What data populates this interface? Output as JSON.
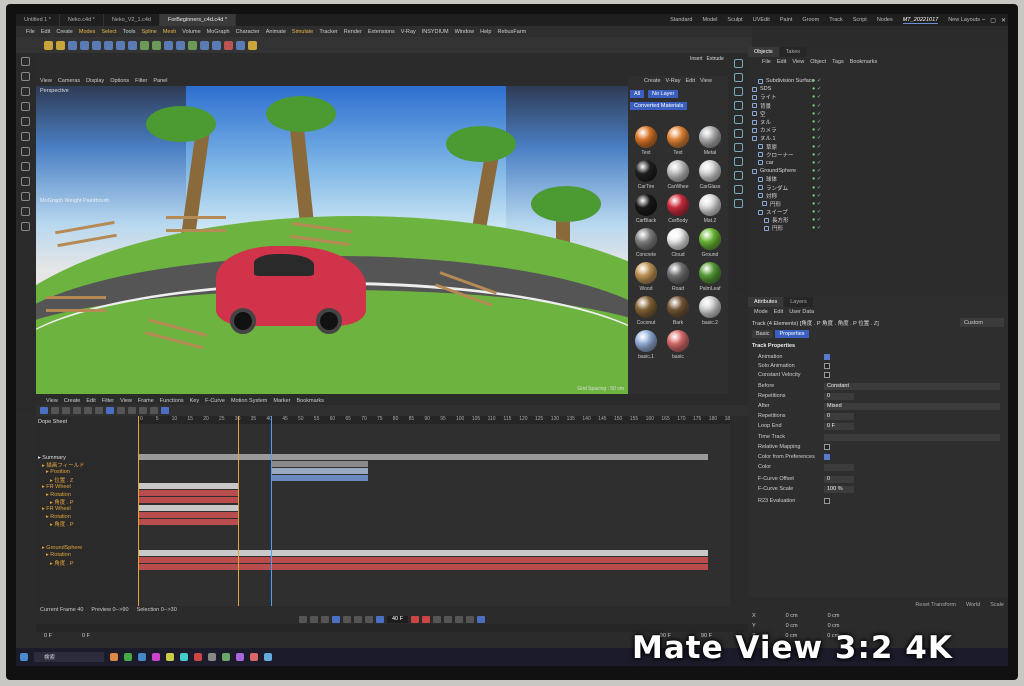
{
  "tabs": [
    "Untitled 1 *",
    "Neko.c4d *",
    "Neko_V2_1.c4d",
    "ForBeginners_c4d.c4d *"
  ],
  "layouts": [
    "Standard",
    "Model",
    "Sculpt",
    "UVEdit",
    "Paint",
    "Groom",
    "Track",
    "Script",
    "Nodes",
    "MT_20221017",
    "New Layouts"
  ],
  "menu": [
    "File",
    "Edit",
    "Create",
    "Modes",
    "Select",
    "Tools",
    "Spline",
    "Mesh",
    "Volume",
    "MoGraph",
    "Character",
    "Animate",
    "Simulate",
    "Tracker",
    "Render",
    "Extensions",
    "V-Ray",
    "INSYDIUM",
    "Window",
    "Help",
    "RebusFarm"
  ],
  "viewport": {
    "menu": [
      "View",
      "Cameras",
      "Display",
      "Options",
      "Filter",
      "Panel"
    ],
    "label": "Perspective",
    "tool": "MoGraph Weight Paintbrush",
    "status": "Grid Spacing : 50 cm"
  },
  "materials": {
    "menu": [
      "Create",
      "V-Ray",
      "Edit",
      "View"
    ],
    "chips": [
      "All",
      "No Layer",
      "Converted Materials"
    ],
    "items": [
      {
        "name": "Text",
        "color": "#e07a2a"
      },
      {
        "name": "Text",
        "color": "#e88a3a"
      },
      {
        "name": "Metal",
        "color": "#b5b5b5"
      },
      {
        "name": "CarTire",
        "color": "#222222"
      },
      {
        "name": "CarWhee",
        "color": "#c8c8c8"
      },
      {
        "name": "CarGlass",
        "color": "#dcdcdc"
      },
      {
        "name": "CarBlack",
        "color": "#1a1a1a"
      },
      {
        "name": "CarBody",
        "color": "#d23040"
      },
      {
        "name": "Mat.2",
        "color": "#e0e0e0"
      },
      {
        "name": "Concrete",
        "color": "#888888"
      },
      {
        "name": "Cloud",
        "color": "#f2f2f2"
      },
      {
        "name": "Ground",
        "color": "#6fbf3a"
      },
      {
        "name": "Wood",
        "color": "#c79a5a"
      },
      {
        "name": "Road",
        "color": "#777777"
      },
      {
        "name": "PalmLeaf",
        "color": "#5aa23a"
      },
      {
        "name": "Coconut",
        "color": "#8a6a3a"
      },
      {
        "name": "Bark",
        "color": "#7a5a3a"
      },
      {
        "name": "basic.2",
        "color": "#d8d8d8"
      },
      {
        "name": "basic.1",
        "color": "#9ab6e0"
      },
      {
        "name": "basic",
        "color": "#e07070"
      }
    ]
  },
  "insert": [
    "Insert",
    "Extrude"
  ],
  "objects": {
    "tabs": [
      "Objects",
      "Takes"
    ],
    "menu": [
      "File",
      "Edit",
      "View",
      "Object",
      "Tags",
      "Bookmarks"
    ],
    "items": [
      "Subdivision Surface",
      "SDS",
      "ライト",
      "背景",
      "空",
      "ヌル",
      "カメラ",
      "ヌル.1",
      "草原",
      "クローナー",
      "car",
      "GroundSphere",
      "球体",
      "ランダム",
      "対称",
      "円形",
      "スイープ",
      "長方形",
      "円形"
    ]
  },
  "attributes": {
    "tabs": [
      "Attributes",
      "Layers"
    ],
    "menu": [
      "Mode",
      "Edit",
      "User Data"
    ],
    "title": "Track (4 Elements) [角度 . P 角度 . 角度 . P 位置 . Z]",
    "custom": "Custom",
    "subtabs": [
      "Basic",
      "Properties"
    ],
    "section": "Track Properties",
    "rows": [
      {
        "label": "Animation",
        "type": "cb",
        "on": true
      },
      {
        "label": "Solo Animation",
        "type": "cb",
        "on": false
      },
      {
        "label": "Constant Velocity",
        "type": "cb",
        "on": false
      },
      {
        "label": "Before",
        "type": "val",
        "value": "Constant"
      },
      {
        "label": "Repetitions",
        "type": "val",
        "value": "0"
      },
      {
        "label": "After",
        "type": "val",
        "value": "Mixed"
      },
      {
        "label": "Repetitions",
        "type": "val",
        "value": "0"
      },
      {
        "label": "Loop End",
        "type": "val",
        "value": "0 F"
      },
      {
        "label": "Time Track",
        "type": "val",
        "value": ""
      },
      {
        "label": "Relative Mapping",
        "type": "cb",
        "on": false
      },
      {
        "label": "Color from Preferences",
        "type": "cb",
        "on": true
      },
      {
        "label": "Color",
        "type": "val",
        "value": ""
      },
      {
        "label": "F-Curve Offset",
        "type": "val",
        "value": "0"
      },
      {
        "label": "F-Curve Scale",
        "type": "val",
        "value": "100 %"
      },
      {
        "label": "R23 Evaluation",
        "type": "cb",
        "on": false
      }
    ]
  },
  "coords": {
    "header": [
      "Reset Transform",
      "World",
      "Scale"
    ],
    "rows": [
      [
        "X",
        "0 cm",
        "0 cm"
      ],
      [
        "Y",
        "0 cm",
        "0 cm"
      ],
      [
        "Z",
        "0 cm",
        "0 cm"
      ]
    ]
  },
  "timeline": {
    "menu": [
      "View",
      "Create",
      "Edit",
      "Filter",
      "View",
      "Frame",
      "Functions",
      "Key",
      "F-Curve",
      "Motion System",
      "Marker",
      "Bookmarks"
    ],
    "label": "Dope Sheet",
    "tracks": [
      {
        "name": "Summary",
        "indent": 0,
        "color": "#dddddd"
      },
      {
        "name": "描画フィールド",
        "indent": 4,
        "color": "#e2a43c"
      },
      {
        "name": "Position",
        "indent": 8,
        "color": "#e2a43c"
      },
      {
        "name": "位置 . Z",
        "indent": 12,
        "color": "#e2a43c"
      },
      {
        "name": "FR Wheel",
        "indent": 4,
        "color": "#e2a43c"
      },
      {
        "name": "Rotation",
        "indent": 8,
        "color": "#e2a43c"
      },
      {
        "name": "角度 . P",
        "indent": 12,
        "color": "#e2a43c"
      },
      {
        "name": "FR Wheel",
        "indent": 4,
        "color": "#e2a43c"
      },
      {
        "name": "Rotation",
        "indent": 8,
        "color": "#e2a43c"
      },
      {
        "name": "角度 . P",
        "indent": 12,
        "color": "#e2a43c"
      },
      {
        "name": "GroundSphere",
        "indent": 4,
        "color": "#e2a43c"
      },
      {
        "name": "Rotation",
        "indent": 8,
        "color": "#e2a43c"
      },
      {
        "name": "角度 . P",
        "indent": 12,
        "color": "#e2a43c"
      }
    ],
    "ticks": [
      "0",
      "5",
      "10",
      "15",
      "20",
      "25",
      "30",
      "35",
      "40",
      "45",
      "50",
      "55",
      "60",
      "65",
      "70",
      "75",
      "80",
      "85",
      "90",
      "95",
      "100",
      "105",
      "110",
      "115",
      "120",
      "125",
      "130",
      "135",
      "140",
      "145",
      "150",
      "155",
      "160",
      "165",
      "170",
      "175",
      "180",
      "185"
    ],
    "status": {
      "current": "Current Frame 40",
      "preview": "Preview 0-->90",
      "selection": "Selection 0-->30"
    },
    "frame": "40 F",
    "bottom": [
      "0 F",
      "0 F",
      "90 F",
      "90 F"
    ]
  },
  "taskbar": {
    "search": "検索"
  },
  "overlay": "Mate View 3:2 4K"
}
